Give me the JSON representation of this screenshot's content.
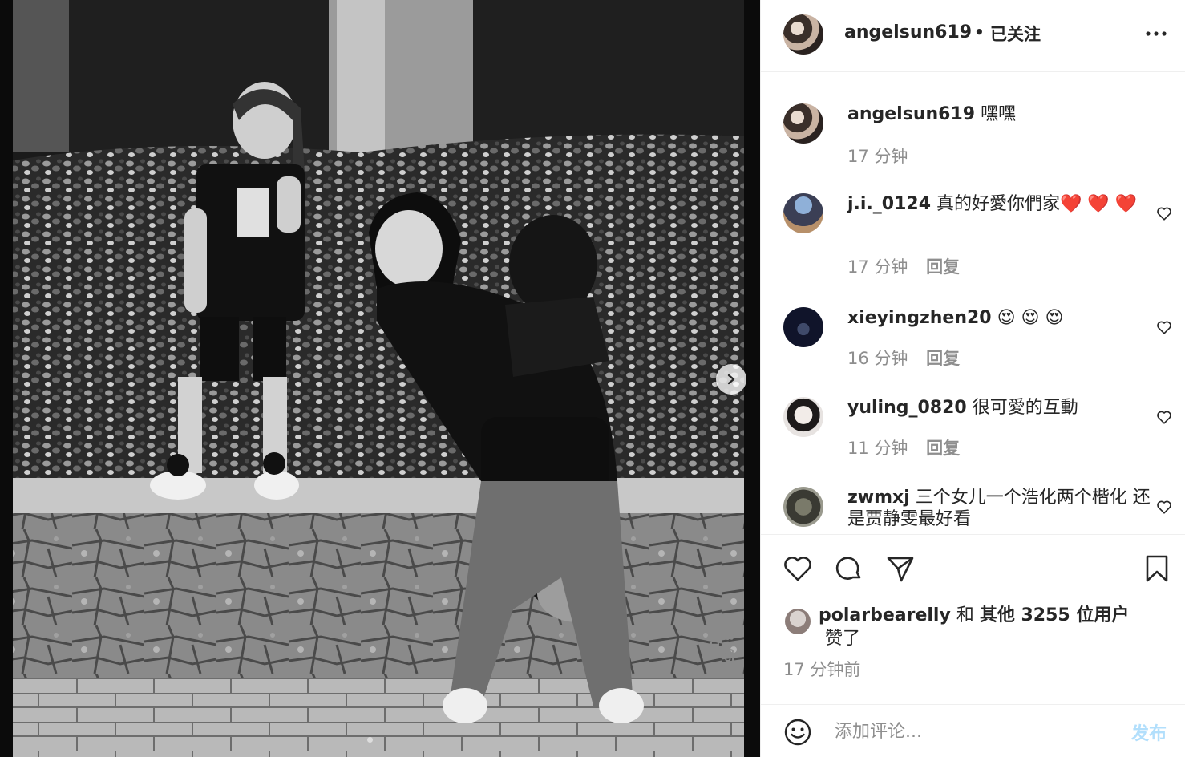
{
  "post": {
    "film_left": "26",
    "film_right": "3405-11",
    "image_alt": ""
  },
  "header": {
    "username": "angelsun619",
    "separator": "•",
    "follow_status": "已关注",
    "more_icon": "more-horizontal-icon"
  },
  "caption": {
    "username": "angelsun619",
    "text": "嘿嘿",
    "time": "17 分钟"
  },
  "comments": [
    {
      "username": "j.i._0124",
      "text": "真的好愛你們家❤️ ❤️ ❤️",
      "time": "17 分钟",
      "reply": "回复"
    },
    {
      "username": "xieyingzhen20",
      "text": "😍 😍 😍",
      "time": "16 分钟",
      "reply": "回复"
    },
    {
      "username": "yuling_0820",
      "text": "很可愛的互動",
      "time": "11 分钟",
      "reply": "回复"
    },
    {
      "username": "zwmxj",
      "text": "三个女儿一个浩化两个楷化 还是贾静雯最好看",
      "time": "",
      "reply": ""
    }
  ],
  "actions": {
    "like_icon": "heart-icon",
    "comment_icon": "comment-icon",
    "share_icon": "paper-plane-icon",
    "save_icon": "bookmark-icon"
  },
  "likes": {
    "first_user": "polarbearelly",
    "conj": "和",
    "others": "其他 3255 位用户",
    "suffix": "赞了"
  },
  "time_ago": "17 分钟前",
  "add_comment": {
    "placeholder": "添加评论...",
    "post_label": "发布"
  },
  "colors": {
    "text": "#262626",
    "muted": "#8e8e8e",
    "post_disabled": "#b2dffc",
    "border": "#efefef"
  }
}
